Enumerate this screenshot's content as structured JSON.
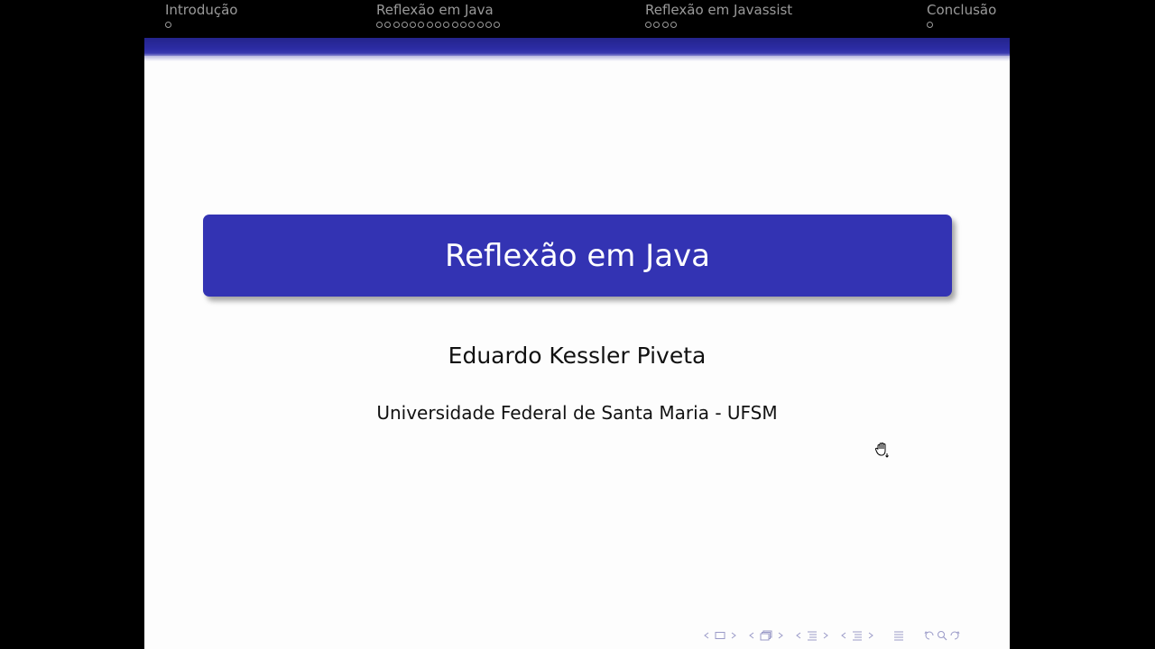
{
  "headline": {
    "sections": [
      {
        "title": "Introdução",
        "dots": 1
      },
      {
        "title": "Reflexão em Java",
        "dots": 15
      },
      {
        "title": "Reflexão em Javassist",
        "dots": 4
      },
      {
        "title": "Conclusão",
        "dots": 1
      }
    ]
  },
  "slide": {
    "title": "Reflexão em Java",
    "author": "Eduardo Kessler Piveta",
    "institute": "Universidade Federal de Santa Maria - UFSM"
  },
  "icons": {
    "cursor": "hand-grab-icon",
    "nav": [
      "arrow-left-icon",
      "frame-icon",
      "arrow-right-icon",
      "arrow-left-icon",
      "subsection-icon",
      "arrow-right-icon",
      "arrow-left-icon",
      "section-icon",
      "arrow-right-icon",
      "arrow-left-icon",
      "subsection-list-icon",
      "arrow-right-icon",
      "align-icon",
      "search-back-icon",
      "search-icon",
      "search-forward-icon"
    ]
  },
  "colors": {
    "accent": "#3333b3",
    "headline_bg": "#000000",
    "nav_text": "#9a9a9a"
  }
}
